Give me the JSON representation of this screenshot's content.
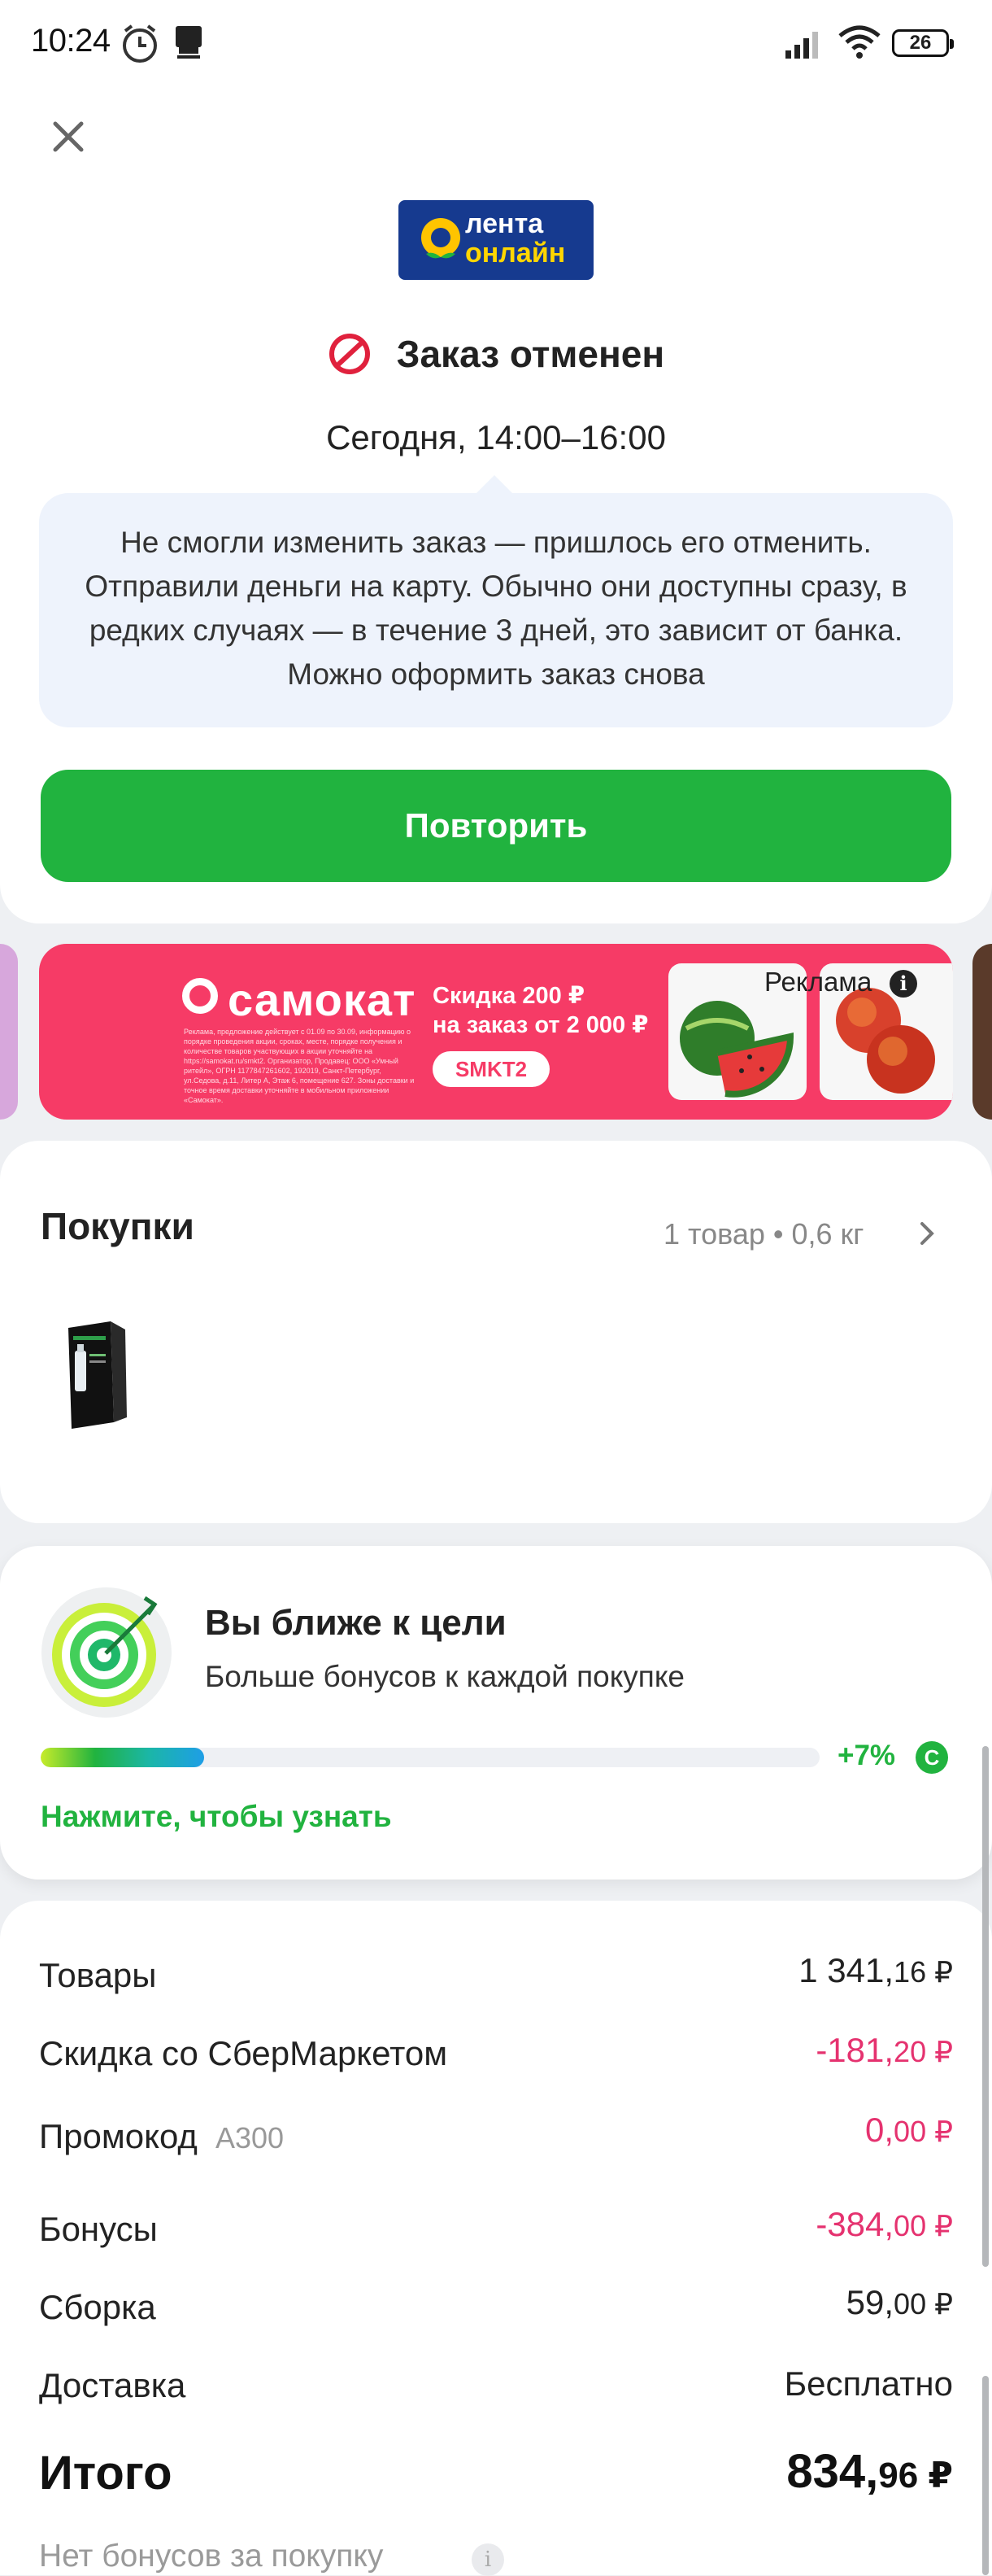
{
  "status_bar": {
    "time": "10:24",
    "battery": "26"
  },
  "header": {
    "logo_line1": "лента",
    "logo_line2": "онлайн",
    "status": "Заказ отменен",
    "delivery_time": "Сегодня, 14:00–16:00",
    "info_text": "Не смогли изменить заказ — пришлось его отменить. Отправили деньги на карту. Обычно они доступны сразу, в редких случаях — в течение 3 дней, это зависит от банка. Можно оформить заказ снова",
    "repeat_button": "Повторить"
  },
  "banner": {
    "brand": "самокат",
    "promo_line1": "Скидка 200 ₽",
    "promo_line2": "на заказ от 2 000 ₽",
    "promo_code": "SMKT2",
    "ad_label": "Реклама",
    "fine_print": "Реклама, предложение действует с 01.09 по 30.09, информацию о порядке проведения акции, сроках, месте, порядке получения и количестве товаров участвующих в акции уточняйте на https://samokat.ru/smkt2. Организатор, Продавец: ООО «Умный ритейл», ОГРН 1177847261602, 192019, Санкт-Петербург, ул.Седова, д.11, Литер А, Этаж 6, помещение 627. Зоны доставки и точное время доставки уточняйте в мобильном приложении «Самокат»."
  },
  "purchases": {
    "title": "Покупки",
    "summary": "1 товар • 0,6 кг"
  },
  "bonus": {
    "title": "Вы ближе к цели",
    "subtitle": "Больше бонусов к каждой покупке",
    "progress_percent": 21,
    "progress_label": "+7%",
    "link": "Нажмите, чтобы узнать"
  },
  "totals": {
    "goods_label": "Товары",
    "goods_main": "1 341,",
    "goods_cents": "16 ₽",
    "discount_label": "Скидка со СберМаркетом",
    "discount_main": "-181,",
    "discount_cents": "20 ₽",
    "promo_label": "Промокод",
    "promo_code": "A300",
    "promo_main": "0,",
    "promo_cents": "00 ₽",
    "bonuses_label": "Бонусы",
    "bonuses_main": "-384,",
    "bonuses_cents": "00 ₽",
    "assembly_label": "Сборка",
    "assembly_main": "59,",
    "assembly_cents": "00 ₽",
    "delivery_label": "Доставка",
    "delivery_value": "Бесплатно",
    "total_label": "Итого",
    "total_main": "834,",
    "total_cents": "96 ₽",
    "no_bonus": "Нет бонусов за покупку"
  },
  "colors": {
    "accent_green": "#21b33f",
    "negative_pink": "#e5326f",
    "banner_red": "#f63b66"
  }
}
